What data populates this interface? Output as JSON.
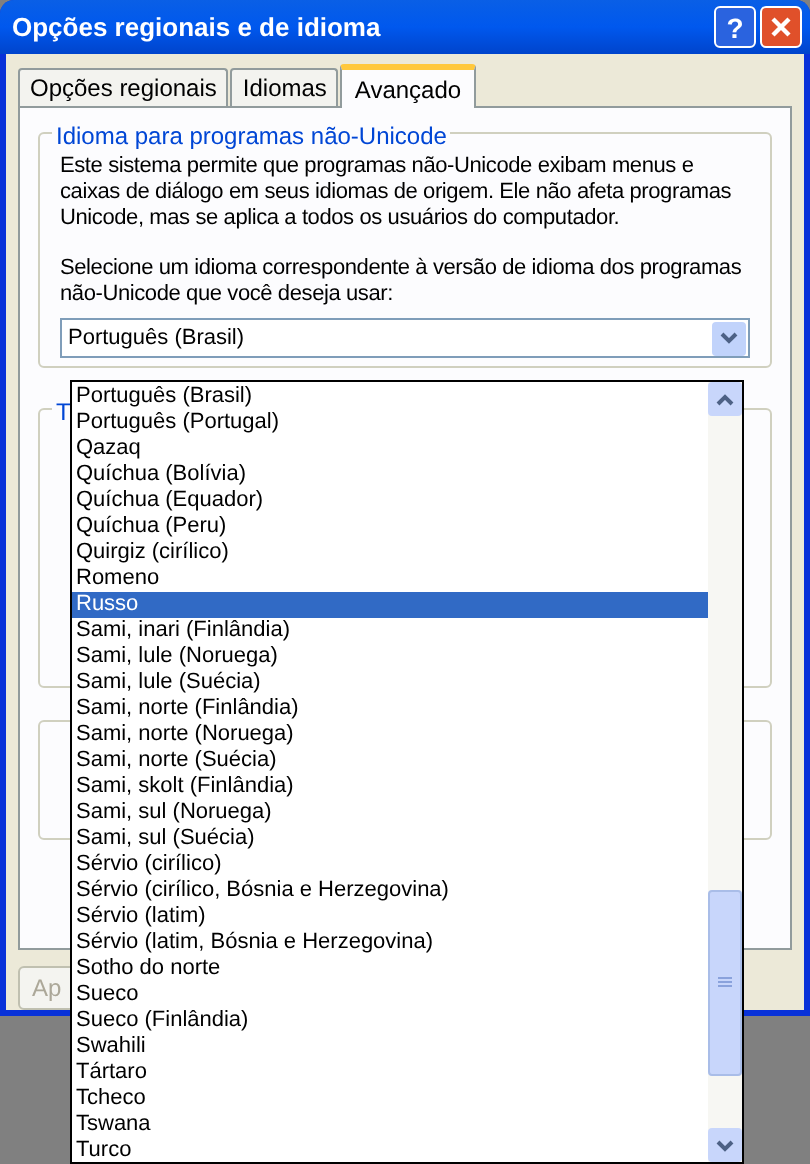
{
  "window": {
    "title": "Opções regionais e de idioma",
    "help_button": "?"
  },
  "tabs": [
    {
      "label": "Opções regionais",
      "selected": false
    },
    {
      "label": "Idiomas",
      "selected": false
    },
    {
      "label": "Avançado",
      "selected": true
    }
  ],
  "non_unicode_group": {
    "legend": "Idioma para programas não-Unicode",
    "description": "Este sistema permite que programas não-Unicode exibam menus e caixas de diálogo em seus idiomas de origem. Ele não afeta programas Unicode, mas se aplica a todos os usuários do computador.",
    "prompt": "Selecione um idioma correspondente à versão de idioma dos programas não-Unicode que você deseja usar:",
    "combo_value": "Português (Brasil)"
  },
  "group_2": {
    "legend": "T"
  },
  "bottom_buttons": [
    "Ap"
  ],
  "dropdown_list": [
    {
      "label": "Português (Brasil)",
      "selected": false
    },
    {
      "label": "Português (Portugal)",
      "selected": false
    },
    {
      "label": "Qazaq",
      "selected": false
    },
    {
      "label": "Quíchua (Bolívia)",
      "selected": false
    },
    {
      "label": "Quíchua (Equador)",
      "selected": false
    },
    {
      "label": "Quíchua (Peru)",
      "selected": false
    },
    {
      "label": "Quirgiz (cirílico)",
      "selected": false
    },
    {
      "label": "Romeno",
      "selected": false
    },
    {
      "label": "Russo",
      "selected": true
    },
    {
      "label": "Sami, inari (Finlândia)",
      "selected": false
    },
    {
      "label": "Sami, lule (Noruega)",
      "selected": false
    },
    {
      "label": "Sami, lule (Suécia)",
      "selected": false
    },
    {
      "label": "Sami, norte (Finlândia)",
      "selected": false
    },
    {
      "label": "Sami, norte (Noruega)",
      "selected": false
    },
    {
      "label": "Sami, norte (Suécia)",
      "selected": false
    },
    {
      "label": "Sami, skolt (Finlândia)",
      "selected": false
    },
    {
      "label": "Sami, sul (Noruega)",
      "selected": false
    },
    {
      "label": "Sami, sul (Suécia)",
      "selected": false
    },
    {
      "label": "Sérvio (cirílico)",
      "selected": false
    },
    {
      "label": "Sérvio (cirílico, Bósnia e Herzegovina)",
      "selected": false
    },
    {
      "label": "Sérvio (latim)",
      "selected": false
    },
    {
      "label": "Sérvio (latim, Bósnia e Herzegovina)",
      "selected": false
    },
    {
      "label": "Sotho do norte",
      "selected": false
    },
    {
      "label": "Sueco",
      "selected": false
    },
    {
      "label": "Sueco (Finlândia)",
      "selected": false
    },
    {
      "label": "Swahili",
      "selected": false
    },
    {
      "label": "Tártaro",
      "selected": false
    },
    {
      "label": "Tcheco",
      "selected": false
    },
    {
      "label": "Tswana",
      "selected": false
    },
    {
      "label": "Turco",
      "selected": false
    }
  ]
}
